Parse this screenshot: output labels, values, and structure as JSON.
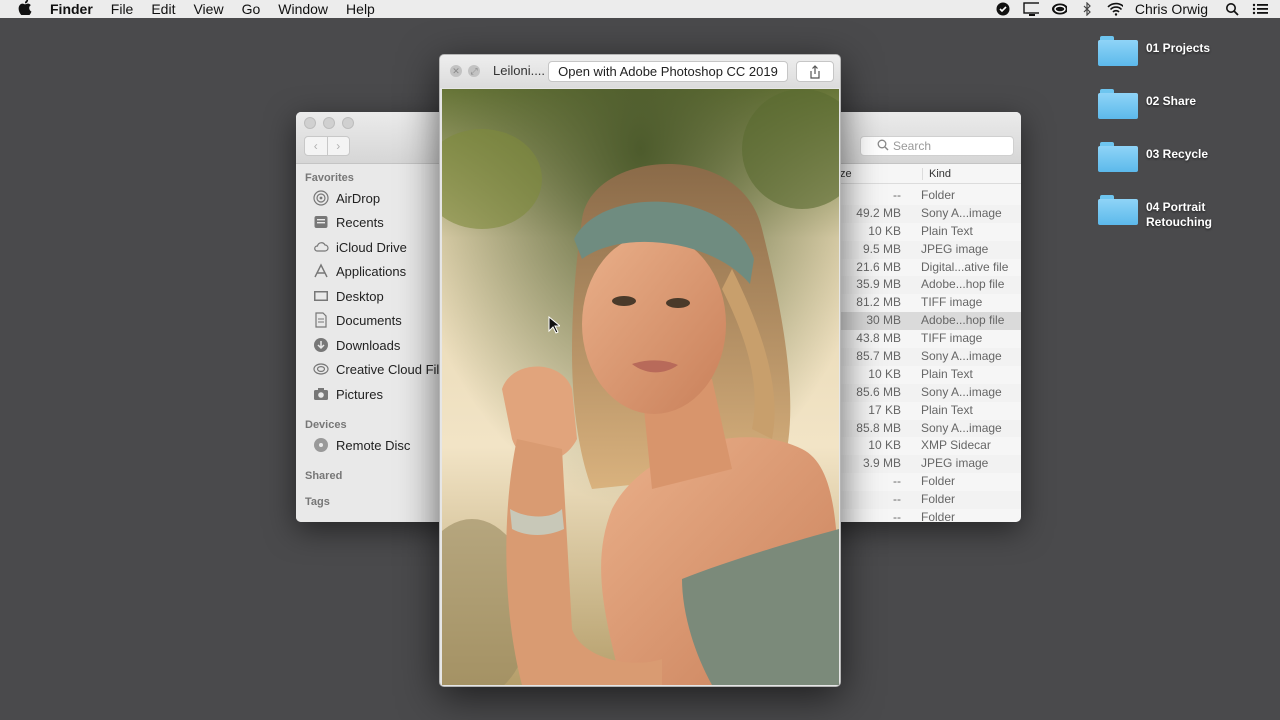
{
  "menubar": {
    "app": "Finder",
    "items": [
      "File",
      "Edit",
      "View",
      "Go",
      "Window",
      "Help"
    ],
    "user": "Chris Orwig"
  },
  "desktop": {
    "items": [
      {
        "label_line1": "01 Projects",
        "label_line2": ""
      },
      {
        "label_line1": "02 Share",
        "label_line2": ""
      },
      {
        "label_line1": "03 Recycle",
        "label_line2": ""
      },
      {
        "label_line1": "04 Portrait",
        "label_line2": "Retouching"
      }
    ]
  },
  "finder": {
    "search_placeholder": "Search",
    "sidebar": {
      "favorites_header": "Favorites",
      "favorites": [
        "AirDrop",
        "Recents",
        "iCloud Drive",
        "Applications",
        "Desktop",
        "Documents",
        "Downloads",
        "Creative Cloud Files",
        "Pictures"
      ],
      "devices_header": "Devices",
      "devices": [
        "Remote Disc"
      ],
      "shared_header": "Shared",
      "tags_header": "Tags"
    },
    "columns": {
      "size": "ze",
      "kind": "Kind"
    },
    "rows": [
      {
        "size": "--",
        "kind": "Folder"
      },
      {
        "size": "49.2 MB",
        "kind": "Sony A...image"
      },
      {
        "size": "10 KB",
        "kind": "Plain Text"
      },
      {
        "size": "9.5 MB",
        "kind": "JPEG image"
      },
      {
        "size": "21.6 MB",
        "kind": "Digital...ative file"
      },
      {
        "size": "35.9 MB",
        "kind": "Adobe...hop file"
      },
      {
        "size": "81.2 MB",
        "kind": "TIFF image"
      },
      {
        "size": "30 MB",
        "kind": "Adobe...hop file"
      },
      {
        "size": "43.8 MB",
        "kind": "TIFF image"
      },
      {
        "size": "85.7 MB",
        "kind": "Sony A...image"
      },
      {
        "size": "10 KB",
        "kind": "Plain Text"
      },
      {
        "size": "85.6 MB",
        "kind": "Sony A...image"
      },
      {
        "size": "17 KB",
        "kind": "Plain Text"
      },
      {
        "size": "85.8 MB",
        "kind": "Sony A...image"
      },
      {
        "size": "10 KB",
        "kind": "XMP Sidecar"
      },
      {
        "size": "3.9 MB",
        "kind": "JPEG image"
      },
      {
        "size": "--",
        "kind": "Folder"
      },
      {
        "size": "--",
        "kind": "Folder"
      },
      {
        "size": "--",
        "kind": "Folder"
      }
    ]
  },
  "quicklook": {
    "filename": "Leiloni....",
    "open_with": "Open with Adobe Photoshop CC 2019",
    "share_icon": "share-icon"
  }
}
